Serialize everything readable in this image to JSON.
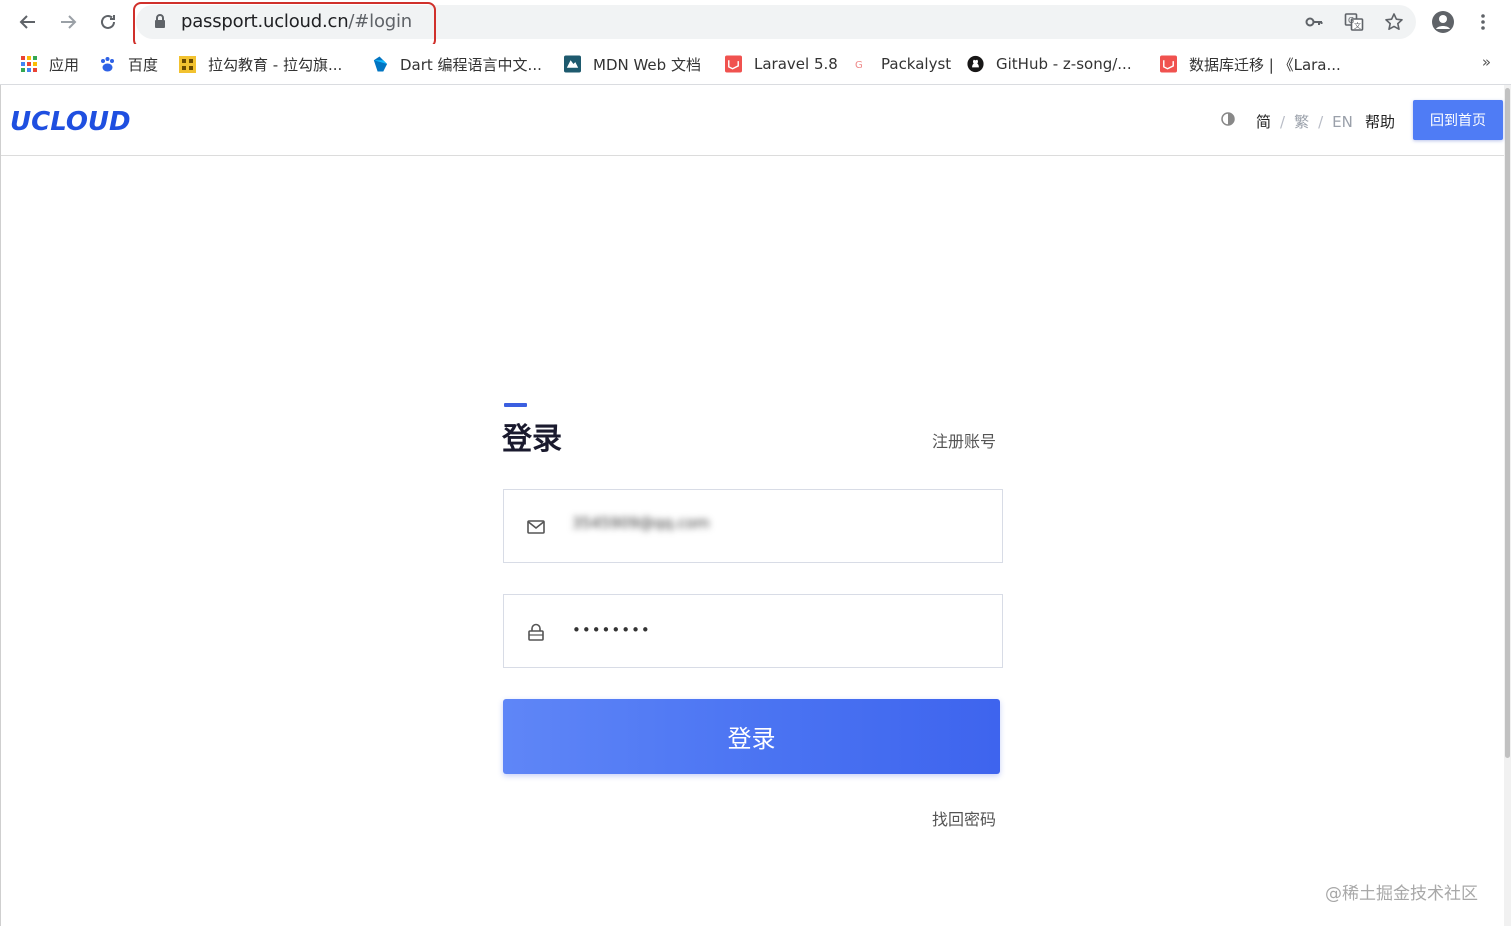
{
  "browser": {
    "url_host": "passport.ucloud.cn",
    "url_path": "/#login",
    "bookmarks": [
      {
        "label": "应用",
        "icon": "apps-grid-icon"
      },
      {
        "label": "百度",
        "icon": "baidu-paw-icon"
      },
      {
        "label": "拉勾教育 - 拉勾旗...",
        "icon": "lagou-icon"
      },
      {
        "label": "Dart 编程语言中文...",
        "icon": "dart-icon"
      },
      {
        "label": "MDN Web 文档",
        "icon": "mdn-icon"
      },
      {
        "label": "Laravel 5.8",
        "icon": "laravel-icon"
      },
      {
        "label": "Packalyst",
        "icon": "packalyst-icon"
      },
      {
        "label": "GitHub - z-song/...",
        "icon": "github-icon"
      },
      {
        "label": "数据库迁移 | 《Lara...",
        "icon": "laravel-icon"
      }
    ],
    "more_bookmarks": "»"
  },
  "header": {
    "logo": "UCLOUD",
    "lang_simplified": "简",
    "lang_traditional": "繁",
    "lang_english": "EN",
    "separator": "/",
    "help": "帮助",
    "home_button": "回到首页"
  },
  "login": {
    "title": "登录",
    "register_link": "注册账号",
    "email_value": "3545909@qq.com",
    "password_value": "••••••••",
    "submit_label": "登录",
    "forgot_link": "找回密码"
  },
  "watermark": "@稀土掘金技术社区",
  "colors": {
    "accent": "#4f7cf5",
    "logo": "#1f4fe0",
    "url_highlight": "#d0302b"
  }
}
